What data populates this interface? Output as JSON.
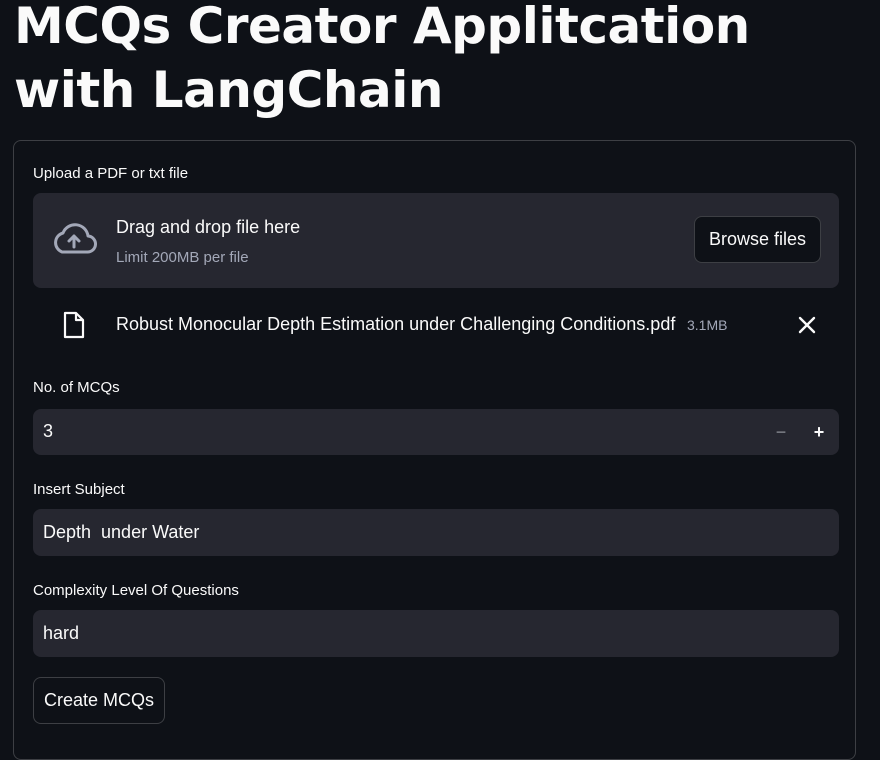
{
  "page": {
    "title": "MCQs Creator Applitcation with LangChain"
  },
  "uploader": {
    "label": "Upload a PDF or txt file",
    "dropzone_text": "Drag and drop file here",
    "limit_text": "Limit 200MB per file",
    "browse_label": "Browse files",
    "upload_icon": "cloud-upload-icon",
    "file": {
      "name": "Robust Monocular Depth Estimation under Challenging Conditions.pdf",
      "size": "3.1MB",
      "icon": "file-icon",
      "remove_icon": "close-icon"
    }
  },
  "mcq_count": {
    "label": "No. of MCQs",
    "value": "3",
    "decrement": "−",
    "increment": "+"
  },
  "subject": {
    "label": "Insert Subject",
    "value": "Depth  under Water"
  },
  "complexity": {
    "label": "Complexity Level Of Questions",
    "value": "hard"
  },
  "submit": {
    "label": "Create MCQs"
  },
  "colors": {
    "background": "#0e1117",
    "widget": "#262730",
    "text": "#fafafa",
    "muted": "#a3a8b8"
  }
}
